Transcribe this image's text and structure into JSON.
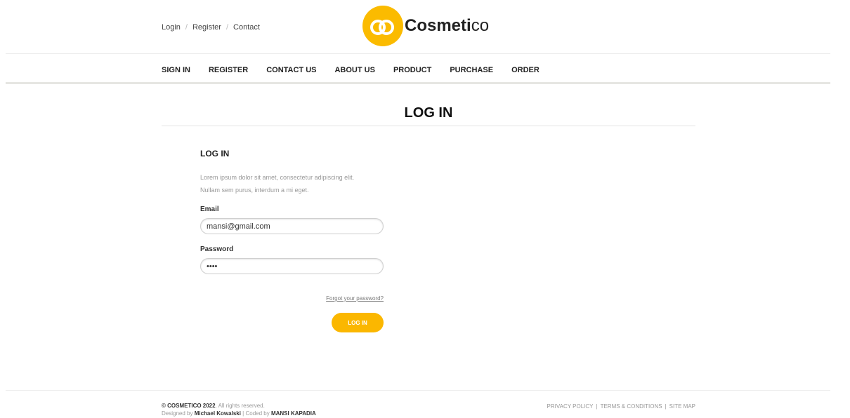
{
  "header": {
    "top_links": [
      "Login",
      "Register",
      "Contact"
    ],
    "separator": "/",
    "logo": {
      "bold": "Cosmeti",
      "thin": "co",
      "color": "#fbbb00"
    }
  },
  "nav": [
    "SIGN IN",
    "REGISTER",
    "CONTACT US",
    "ABOUT US",
    "PRODUCT",
    "PURCHASE",
    "ORDER"
  ],
  "page": {
    "title": "LOG IN"
  },
  "form": {
    "heading": "LOG IN",
    "desc_line1": "Lorem ipsum dolor sit amet, consectetur adipiscing elit.",
    "desc_line2": "Nullam sem purus, interdum a mi eget.",
    "email_label": "Email",
    "email_value": "mansi@gmail.com",
    "password_label": "Password",
    "password_value": "1234",
    "forgot_link": "Forgot your password?",
    "submit_label": "LOG IN",
    "accent": "#fbb700"
  },
  "footer": {
    "copyright_brand": "© COSMETICO 2022",
    "copyright_rest": ". All rights reserved.",
    "designed_by_prefix": "Designed by ",
    "designer": "Michael Kowalski",
    "coded_by_prefix": " | Coded by ",
    "coder": "MANSI KAPADIA",
    "links": [
      "PRIVACY POLICY",
      "TERMS & CONDITIONS",
      "SITE MAP"
    ],
    "links_separator": "|"
  }
}
